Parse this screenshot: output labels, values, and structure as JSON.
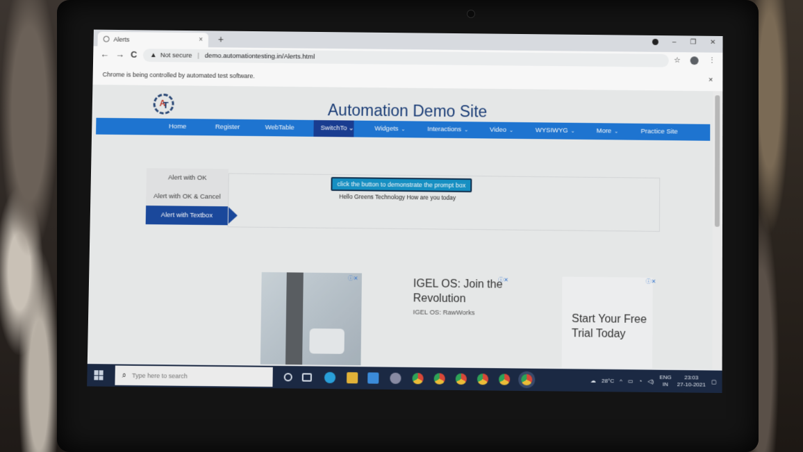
{
  "browser": {
    "tab_title": "Alerts",
    "tab_close": "×",
    "new_tab": "+",
    "back": "←",
    "forward": "→",
    "reload": "C",
    "security_label": "Not secure",
    "url": "demo.automationtesting.in/Alerts.html",
    "infobar_message": "Chrome is being controlled by automated test software.",
    "infobar_close": "×",
    "window_minimize": "–",
    "window_restore": "❐",
    "window_close": "✕"
  },
  "site": {
    "title": "Automation Demo Site",
    "nav": [
      {
        "label": "Home"
      },
      {
        "label": "Register"
      },
      {
        "label": "WebTable"
      },
      {
        "label": "SwitchTo"
      },
      {
        "label": "Widgets"
      },
      {
        "label": "Interactions"
      },
      {
        "label": "Video"
      },
      {
        "label": "WYSIWYG"
      },
      {
        "label": "More"
      },
      {
        "label": "Practice Site"
      }
    ],
    "left_menu": [
      {
        "label": "Alert with OK"
      },
      {
        "label": "Alert with OK & Cancel"
      },
      {
        "label": "Alert with Textbox"
      }
    ],
    "prompt_button": "click the button to demonstrate the prompt box",
    "prompt_result": "Hello Greens Technology How are you today"
  },
  "ads": {
    "ad_choice": "ⓘ✕",
    "ad2_title": "IGEL OS: Join the Revolution",
    "ad2_sub": "IGEL OS: RawWorks",
    "ad3_title": "Start Your Free Trial Today"
  },
  "taskbar": {
    "search_placeholder": "Type here to search",
    "weather": "28°C",
    "lang_top": "ENG",
    "lang_bottom": "IN",
    "time": "23:03",
    "date": "27-10-2021"
  },
  "colors": {
    "nav_bg": "#1f78d6",
    "nav_active": "#1a3e94",
    "title": "#1c3f7a",
    "taskbar": "#1c2a45"
  }
}
